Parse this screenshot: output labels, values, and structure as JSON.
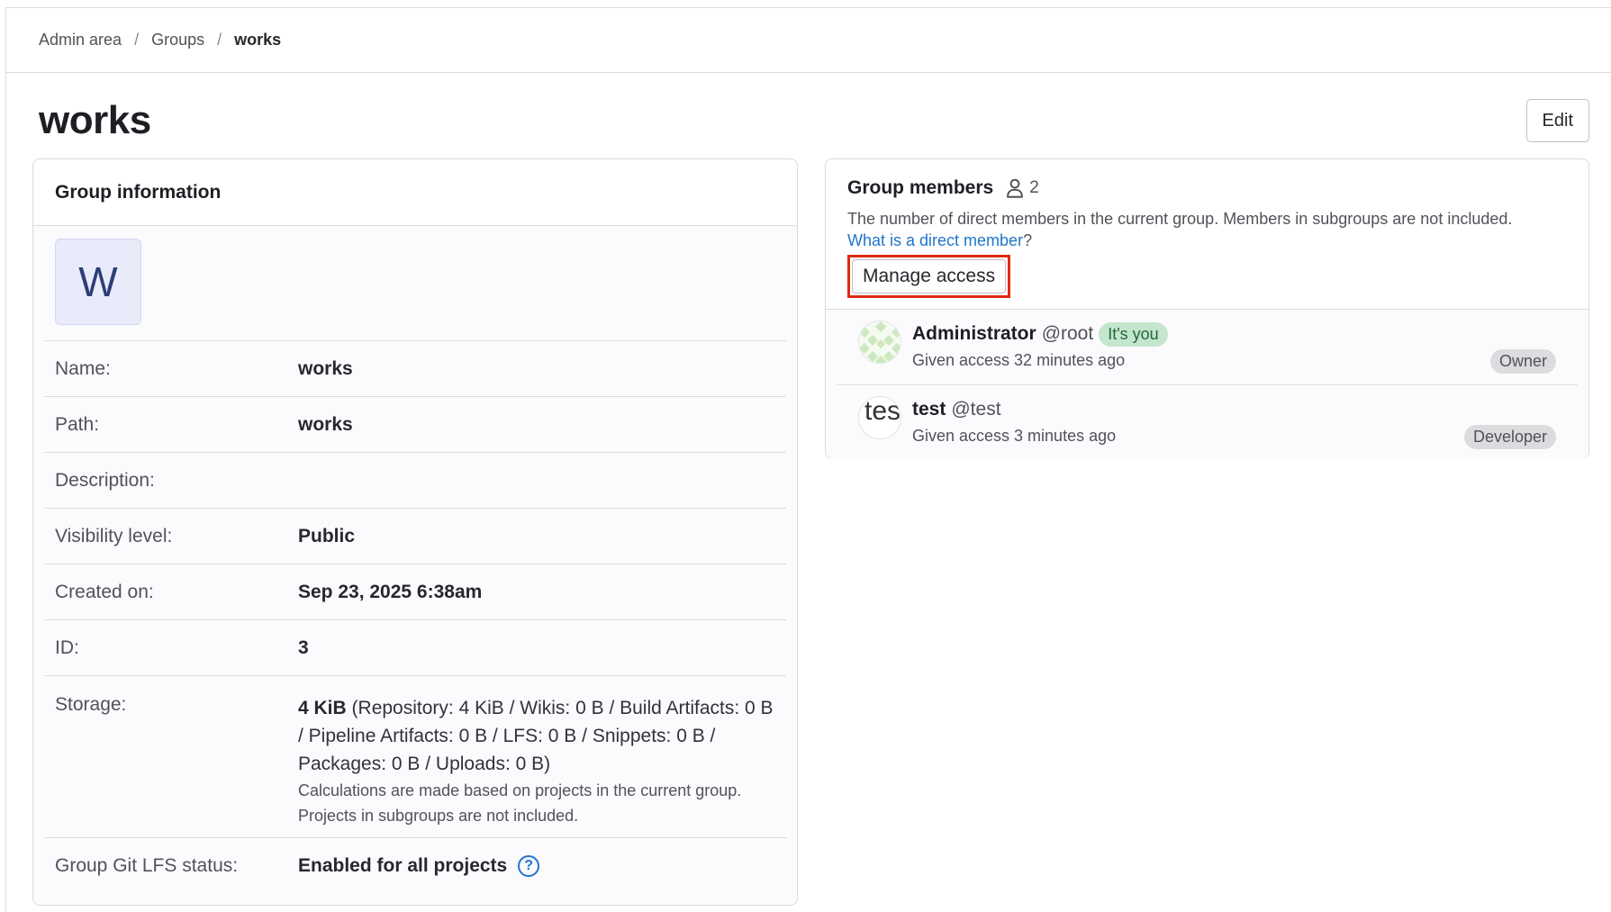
{
  "breadcrumb": {
    "items": [
      "Admin area",
      "Groups"
    ],
    "separator": "/",
    "current": "works"
  },
  "page": {
    "title": "works",
    "edit_label": "Edit"
  },
  "group_info": {
    "heading": "Group information",
    "avatar_letter": "W",
    "rows": {
      "name": {
        "label": "Name:",
        "value": "works"
      },
      "path": {
        "label": "Path:",
        "value": "works"
      },
      "description": {
        "label": "Description:",
        "value": ""
      },
      "visibility": {
        "label": "Visibility level:",
        "value": "Public"
      },
      "created": {
        "label": "Created on:",
        "value": "Sep 23, 2025 6:38am"
      },
      "id": {
        "label": "ID:",
        "value": "3"
      },
      "storage": {
        "label": "Storage:",
        "total": "4 KiB",
        "breakdown": "(Repository: 4 KiB / Wikis: 0 B / Build Artifacts: 0 B / Pipeline Artifacts: 0 B / LFS: 0 B / Snippets: 0 B / Packages: 0 B / Uploads: 0 B)",
        "note": "Calculations are made based on projects in the current group. Projects in subgroups are not included."
      },
      "lfs": {
        "label": "Group Git LFS status:",
        "value": "Enabled for all projects",
        "help_icon": "question-circle-icon"
      }
    }
  },
  "members": {
    "title": "Group members",
    "count_icon": "user-icon",
    "count": "2",
    "description": "The number of direct members in the current group. Members in subgroups are not included.",
    "link_text": "What is a direct member",
    "link_suffix": "?",
    "manage_label": "Manage access",
    "list": [
      {
        "name": "Administrator",
        "handle": "@root",
        "badge": "It's you",
        "meta": "Given access 32 minutes ago",
        "role": "Owner"
      },
      {
        "name": "test",
        "handle": "@test",
        "avatar_alt": "test",
        "meta": "Given access 3 minutes ago",
        "role": "Developer"
      }
    ]
  },
  "colors": {
    "accent_link": "#1f75cb",
    "highlight_box": "#dd2b0e",
    "you_badge_bg": "#c3e6cd",
    "role_badge_bg": "#dcdcde"
  }
}
